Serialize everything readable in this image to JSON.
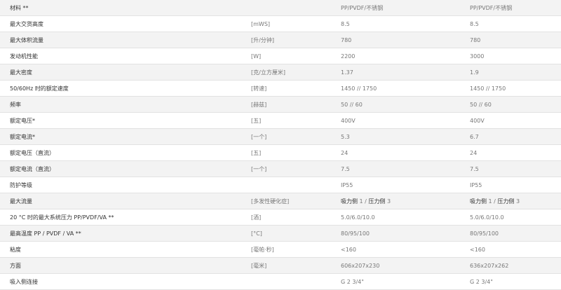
{
  "spec_table": {
    "rows": [
      {
        "param": "材料 **",
        "unit": "",
        "v1": "PP/PVDF/不锈钢",
        "v2": "PP/PVDF/不锈钢"
      },
      {
        "param": "最大交货高度",
        "unit": "[mWS]",
        "v1": "8.5",
        "v2": "8.5"
      },
      {
        "param": "最大体积流量",
        "unit": "[升/分钟]",
        "v1": "780",
        "v2": "780"
      },
      {
        "param": "发动机性能",
        "unit": "[W]",
        "v1": "2200",
        "v2": "3000"
      },
      {
        "param": "最大密度",
        "unit": "[克/立方厘米]",
        "v1": "1.37",
        "v2": "1.9"
      },
      {
        "param": "50/60Hz 时的额定速度",
        "unit": "[转速]",
        "v1": "1450 // 1750",
        "v2": "1450 // 1750"
      },
      {
        "param": "频率",
        "unit": "[赫兹]",
        "v1": "50 // 60",
        "v2": "50 // 60"
      },
      {
        "param": "额定电压*",
        "unit": "[五]",
        "v1": "400V",
        "v2": "400V"
      },
      {
        "param": "额定电流*",
        "unit": "[一个]",
        "v1": "5.3",
        "v2": "6.7"
      },
      {
        "param": "额定电压（直流）",
        "unit": "[五]",
        "v1": "24",
        "v2": "24"
      },
      {
        "param": "额定电流（直流）",
        "unit": "[一个]",
        "v1": "7.5",
        "v2": "7.5"
      },
      {
        "param": "防护等级",
        "unit": "",
        "v1": "IP55",
        "v2": "IP55"
      },
      {
        "param": "最大流量",
        "unit": "[多发性硬化症]",
        "v1_a": "吸力侧",
        "v1_b": " 1 / ",
        "v1_c": "压力侧",
        "v1_d": " 3",
        "v2_a": "吸力侧",
        "v2_b": " 1 / ",
        "v2_c": "压力侧",
        "v2_d": " 3"
      },
      {
        "param": "20 °C 时的最大系统压力 PP/PVDF/VA **",
        "unit": "[酒]",
        "v1": "5.0/6.0/10.0",
        "v2": "5.0/6.0/10.0"
      },
      {
        "param": "最高温度 PP / PVDF / VA **",
        "unit": "[°C]",
        "v1": "80/95/100",
        "v2": "80/95/100"
      },
      {
        "param": "粘度",
        "unit": "[毫帕·秒]",
        "v1": "<160",
        "v2": "<160"
      },
      {
        "param": "方面",
        "unit": "[毫米]",
        "v1": "606x207x230",
        "v2": "636x207x262"
      },
      {
        "param": "吸入侧连接",
        "unit": "",
        "v1": "G 2 3/4\"",
        "v2": "G 2 3/4\""
      }
    ]
  }
}
